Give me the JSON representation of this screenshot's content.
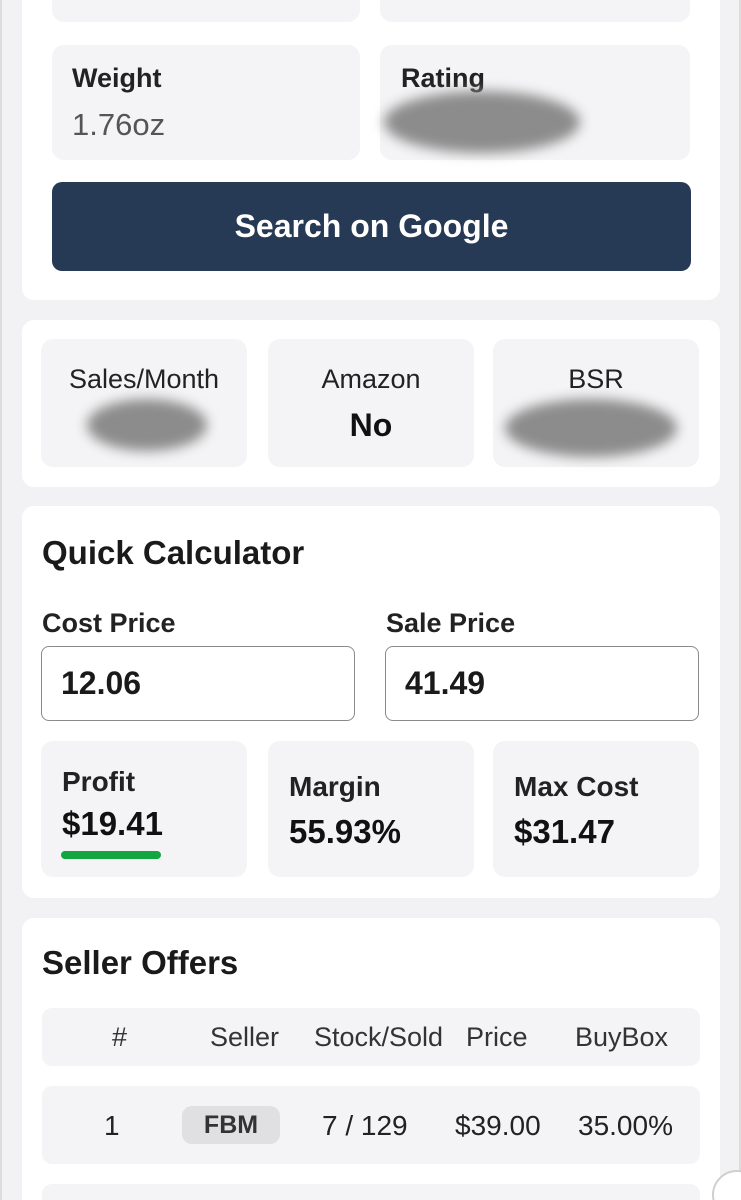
{
  "product": {
    "weight_label": "Weight",
    "weight_value": "1.76oz",
    "rating_label": "Rating",
    "search_button": "Search on Google"
  },
  "stats": {
    "sales_label": "Sales/Month",
    "amazon_label": "Amazon",
    "amazon_value": "No",
    "bsr_label": "BSR"
  },
  "calculator": {
    "title": "Quick Calculator",
    "cost_label": "Cost Price",
    "cost_value": "12.06",
    "sale_label": "Sale Price",
    "sale_value": "41.49",
    "profit_label": "Profit",
    "profit_value": "$19.41",
    "margin_label": "Margin",
    "margin_value": "55.93%",
    "maxcost_label": "Max Cost",
    "maxcost_value": "$31.47"
  },
  "offers": {
    "title": "Seller Offers",
    "columns": [
      "#",
      "Seller",
      "Stock/Sold",
      "Price",
      "BuyBox"
    ],
    "rows": [
      {
        "num": "1",
        "seller": "FBM",
        "stock_sold": "7 / 129",
        "price": "$39.00",
        "buybox": "35.00%"
      }
    ]
  },
  "colors": {
    "primary_button": "#263955",
    "profit_indicator": "#11a640"
  }
}
